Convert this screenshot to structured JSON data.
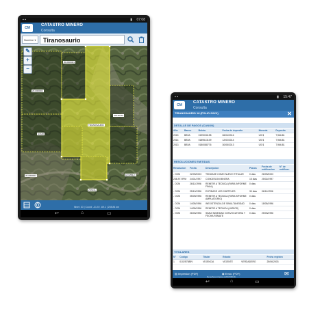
{
  "tablet1": {
    "status": {
      "time": "07:08"
    },
    "app": {
      "title": "CATASTRO MINERO",
      "subtitle": "Consulta"
    },
    "search": {
      "dropdown": "Nombre",
      "value": "Tiranosaurio"
    },
    "map_labels": [
      "20-0000001",
      "20-0000001",
      "GOHD",
      "TIRANOSAURIO",
      "El DIABLO",
      "AGUACAL",
      "ZONDA",
      "20-0000001"
    ],
    "footer": "Nivel: 20 | Coord: -31.5 / -69.1 | 208.84 km"
  },
  "tablet2": {
    "status": {
      "time": "15:47"
    },
    "app": {
      "title": "CATASTRO MINERO",
      "subtitle": "Consulta"
    },
    "record_title": "TIRANOSAURIO 18 (FOLIO 2XXX)",
    "sections": {
      "payments": {
        "title": "DETALLE DE PAGOS (CANON)",
        "headers": [
          "Año",
          "Banco",
          "Boleta",
          "Fecha de deposito",
          "Moneda",
          "Deposito"
        ],
        "rows": [
          [
            "2015",
            "BBVA",
            "0199026198",
            "06/04/2016",
            "US $",
            "7,966.81"
          ],
          [
            "2014",
            "BBVA",
            "0189513109",
            "12/02/2014",
            "US $",
            "7,966.81"
          ],
          [
            "2013",
            "BBVA",
            "0180088776",
            "30/05/2013",
            "US $",
            "7,966.81"
          ]
        ]
      },
      "resolutions": {
        "title": "RESOLUCIONES EMITIDAS",
        "headers": [
          "Resolucion",
          "Fecha",
          "Descripcion",
          "Plazos",
          "Fecha de notificacion",
          "N° de notificac."
        ],
        "rows": [
          [
            "- OCM",
            "22/09/2003",
            "TENGASE COMO NUEVO TITULAR",
            "0 dias",
            "26/09/2003",
            ""
          ],
          [
            "238-97-RPM",
            "24/01/1997",
            "CONCESION MINERA",
            "15 dias",
            "25/02/1997",
            ""
          ],
          [
            "- OCM",
            "26/11/1996",
            "REMITIR A TECNICA (PARA INFORME FINAL)",
            "0 dias",
            "",
            ""
          ],
          [
            "- OCM",
            "25/10/1996",
            "EXPIDASE LOS CARTELES",
            "30 dias",
            "06/11/1996",
            ""
          ],
          [
            "- OCM",
            "05/09/1996",
            "REMITIR A TECNICA (PARA INFORME AMPLIATORIO)",
            "0 dias",
            "",
            ""
          ],
          [
            "- OCM",
            "14/05/1996",
            "INEXISTENCIA DE SIMULTANEIDAD",
            "0 dias",
            "18/05/1996",
            ""
          ],
          [
            "- OCM",
            "14/05/1996",
            "REMITIR A TECNICA (VARIOS)",
            "0 dias",
            "",
            ""
          ],
          [
            "- OCM",
            "26/03/1996",
            "SIMULTANEIDAD CONVOCATORIA Y FECHA REMATE",
            "0 dias",
            "25/03/1996",
            ""
          ]
        ]
      },
      "owners": {
        "title": "TITULARES",
        "headers": [
          "N°",
          "Codigo",
          "Titular",
          "Estado",
          "Fecha registro"
        ],
        "rows": [
          [
            "1",
            "010257585V",
            "VIGENCIA",
            "VIGENTE",
            "VERDADERO",
            "25/06/2003"
          ]
        ]
      }
    },
    "bottom": {
      "left": "Impresion (PDF)",
      "mid": "Envio (PDF)"
    },
    "footer": "Derechos mineros | 2015 08:16"
  }
}
